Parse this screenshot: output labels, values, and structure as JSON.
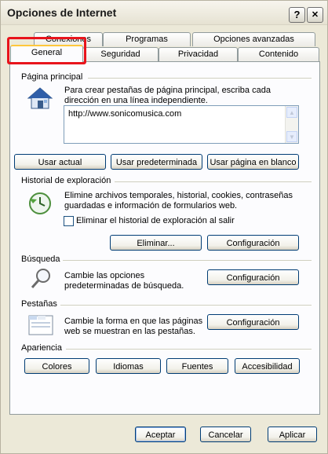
{
  "window": {
    "title": "Opciones de Internet"
  },
  "title_buttons": {
    "help": "?",
    "close": "✕"
  },
  "tabs_row1": [
    "Conexiones",
    "Programas",
    "Opciones avanzadas"
  ],
  "tabs_row2": [
    "General",
    "Seguridad",
    "Privacidad",
    "Contenido"
  ],
  "home": {
    "group_title": "Página principal",
    "description": "Para crear pestañas de página principal, escriba cada dirección en una línea independiente.",
    "url": "http://www.sonicomusica.com",
    "btn_current": "Usar actual",
    "btn_default": "Usar predeterminada",
    "btn_blank": "Usar página en blanco"
  },
  "history": {
    "group_title": "Historial de exploración",
    "description": "Elimine archivos temporales, historial, cookies, contraseñas guardadas e información de formularios web.",
    "checkbox_label": "Eliminar el historial de exploración al salir",
    "btn_delete": "Eliminar...",
    "btn_config": "Configuración"
  },
  "search": {
    "group_title": "Búsqueda",
    "description": "Cambie las opciones predeterminadas de búsqueda.",
    "btn_config": "Configuración"
  },
  "tabs_group": {
    "group_title": "Pestañas",
    "description": "Cambie la forma en que las páginas web se muestran en las pestañas.",
    "btn_config": "Configuración"
  },
  "appearance": {
    "group_title": "Apariencia",
    "btn_colors": "Colores",
    "btn_languages": "Idiomas",
    "btn_fonts": "Fuentes",
    "btn_accessibility": "Accesibilidad"
  },
  "footer": {
    "accept": "Aceptar",
    "cancel": "Cancelar",
    "apply": "Aplicar"
  }
}
